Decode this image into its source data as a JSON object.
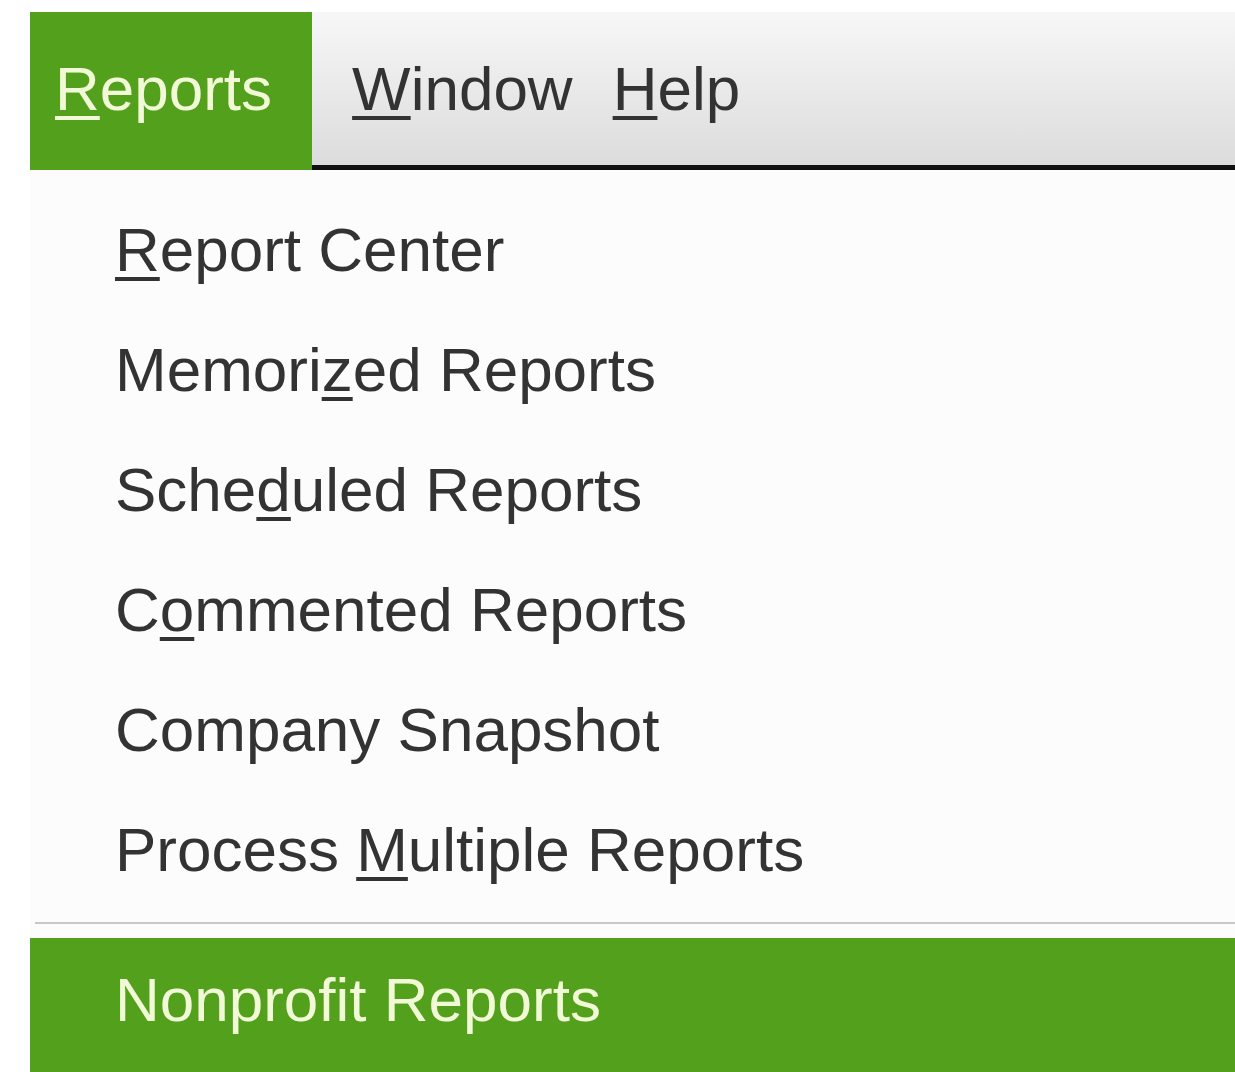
{
  "menu_bar": [
    {
      "key": "R",
      "after": "eports",
      "selected": true
    },
    {
      "key": "W",
      "after": "indow",
      "selected": false
    },
    {
      "key": "H",
      "after": "elp",
      "selected": false
    }
  ],
  "menu": {
    "items": [
      {
        "kind": "item",
        "key": "R",
        "after": "eport Center",
        "selected": false
      },
      {
        "kind": "item",
        "before": "Memori",
        "key": "z",
        "after": "ed Reports",
        "selected": false
      },
      {
        "kind": "item",
        "before": "Sche",
        "key": "d",
        "after": "uled Reports",
        "selected": false
      },
      {
        "kind": "item",
        "before": "C",
        "key": "o",
        "after": "mmented Reports",
        "selected": false
      },
      {
        "kind": "item",
        "before": "Company Snapshot",
        "selected": false
      },
      {
        "kind": "item",
        "before": "Process ",
        "key": "M",
        "after": "ultiple Reports",
        "selected": false
      },
      {
        "kind": "separator"
      },
      {
        "kind": "item",
        "before": "Nonprofit Reports",
        "selected": true
      }
    ]
  }
}
